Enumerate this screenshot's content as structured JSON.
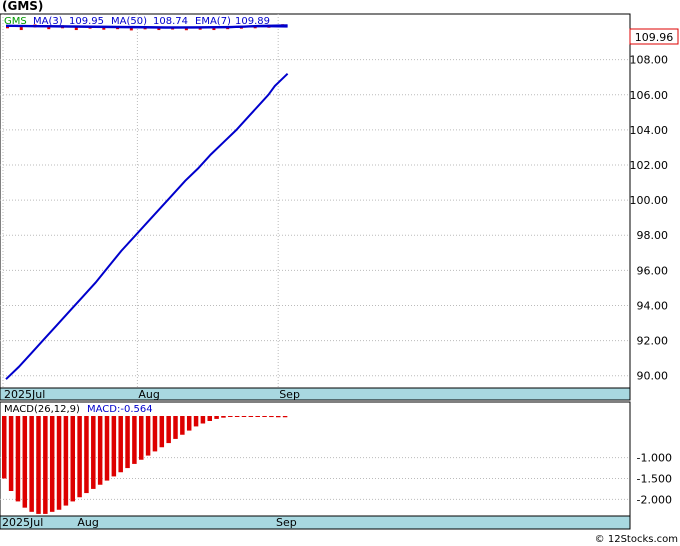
{
  "header": {
    "ticker_title": "(GMS)"
  },
  "legend": {
    "symbol": "GMS",
    "ma3_label": "MA(3)",
    "ma3_value": "109.95",
    "ma50_label": "MA(50)",
    "ma50_value": "108.74",
    "ema7_label": "EMA(7)",
    "ema7_value": "109.89"
  },
  "last_price_label": "109.96",
  "watermark": "© 12Stocks.com",
  "colors": {
    "price": "#0000cc",
    "down": "#dd0000",
    "legend_symbol": "#009900",
    "axis_band": "#a8d8e0",
    "grid": "#bbbbbb"
  },
  "chart_data": [
    {
      "type": "line",
      "panel": "price",
      "yticks": [
        "90.00",
        "92.00",
        "94.00",
        "96.00",
        "98.00",
        "100.00",
        "102.00",
        "104.00",
        "106.00",
        "108.00"
      ],
      "ylim": [
        89.3,
        110.6
      ],
      "x_labels": [
        "2025Jul",
        "Aug",
        "Sep"
      ],
      "x_label_index": [
        0,
        21,
        43
      ],
      "n_days": 50,
      "series": [
        {
          "name": "MA(50)",
          "x": [
            0,
            2,
            4,
            6,
            8,
            10,
            12,
            14,
            16,
            18,
            20,
            22,
            24,
            26,
            28,
            30,
            32,
            34,
            36,
            38,
            40,
            41,
            42,
            44
          ],
          "values": [
            89.8,
            90.5,
            91.3,
            92.1,
            92.9,
            93.7,
            94.5,
            95.3,
            96.2,
            97.1,
            97.9,
            98.7,
            99.5,
            100.3,
            101.1,
            101.8,
            102.6,
            103.3,
            104.0,
            104.8,
            105.6,
            106.0,
            106.5,
            107.2
          ]
        },
        {
          "name": "MA(3)",
          "x": [
            0,
            10,
            20,
            25,
            30,
            35,
            40,
            44
          ],
          "values": [
            109.93,
            109.88,
            109.84,
            109.82,
            109.83,
            109.85,
            109.93,
            109.95
          ]
        },
        {
          "name": "EMA(7)",
          "x": [
            0,
            10,
            20,
            25,
            30,
            35,
            40,
            44
          ],
          "values": [
            109.92,
            109.9,
            109.86,
            109.84,
            109.84,
            109.86,
            109.91,
            109.89
          ]
        }
      ]
    },
    {
      "type": "bar",
      "panel": "macd",
      "title": "MACD(26,12,9)",
      "value_label": "MACD:-0.564",
      "yticks": [
        "-1.000",
        "-1.500",
        "-2.000"
      ],
      "ylim": [
        -2.4,
        0.0
      ],
      "x_labels": [
        "2025Jul",
        "Aug",
        "Sep"
      ],
      "x_label_index": [
        0,
        11,
        40
      ],
      "values": [
        -1.5,
        -1.8,
        -2.05,
        -2.2,
        -2.3,
        -2.35,
        -2.35,
        -2.3,
        -2.25,
        -2.15,
        -2.05,
        -1.95,
        -1.85,
        -1.75,
        -1.65,
        -1.55,
        -1.45,
        -1.35,
        -1.25,
        -1.15,
        -1.05,
        -0.95,
        -0.85,
        -0.75,
        -0.65,
        -0.55,
        -0.45,
        -0.35,
        -0.25,
        -0.18,
        -0.12,
        -0.07,
        -0.04,
        -0.02,
        -0.01,
        -0.005,
        -0.01,
        -0.015,
        -0.02,
        -0.025,
        -0.03,
        -0.03
      ]
    }
  ]
}
